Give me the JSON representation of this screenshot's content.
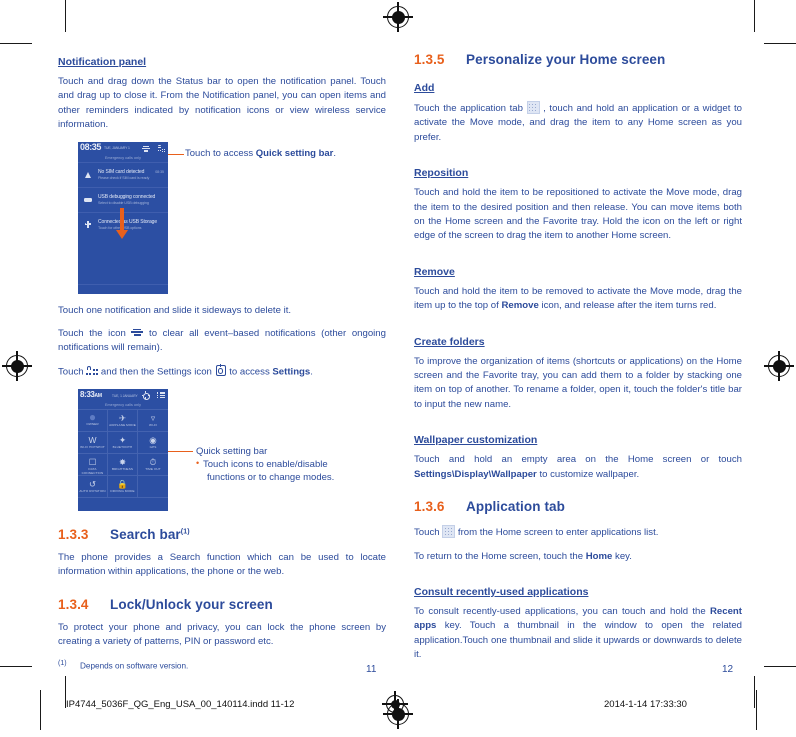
{
  "page": {
    "left_page_number": "11",
    "right_page_number": "12",
    "slug_left": "IP4744_5036F_QG_Eng_USA_00_140114.indd   11-12",
    "slug_right": "2014-1-14   17:33:30",
    "accent_orange": "#e8601c",
    "text_blue": "#2c4b9b",
    "screen_blue": "#2c4fa3"
  },
  "left_column": {
    "heading_notification_panel": "Notification panel",
    "para_1": "Touch and drag down the Status bar to open the notification panel. Touch and drag up to close it. From the Notification panel, you can open items and other reminders indicated by notification icons or view wireless service information.",
    "callout_1_prefix": "Touch to access ",
    "callout_1_bold": "Quick setting bar",
    "callout_1_suffix": ".",
    "para_2": "Touch one notification and slide it sideways to delete it.",
    "para_3_a": "Touch the icon ",
    "para_3_b": " to clear all event–based notifications (other ongoing notifications will remain).",
    "para_4_a": "Touch ",
    "para_4_b": " and then the Settings icon ",
    "para_4_c": " to access ",
    "para_4_bold": "Settings",
    "para_4_d": ".",
    "callout_2_title": "Quick setting bar",
    "callout_2_bullet_line1": "Touch icons to enable/disable",
    "callout_2_bullet_line2": "functions or to change modes.",
    "section_133_num": "1.3.3",
    "section_133_title": "Search bar",
    "section_133_sup": "(1)",
    "section_133_body": "The phone provides a Search function which can be used to locate information within applications, the phone or the web.",
    "section_134_num": "1.3.4",
    "section_134_title": "Lock/Unlock your screen",
    "section_134_body": "To protect your phone and privacy, you can lock the phone screen by creating a variety of patterns, PIN or password etc.",
    "footnote_mark": "(1)",
    "footnote_text": "Depends on software version."
  },
  "phone_notification_shot": {
    "status_time": "08:35",
    "status_date": "TUE, JANUARY 1",
    "carrier_text": "Emergency calls only",
    "status_icons": [
      "clear-all-icon",
      "quick-setting-icon"
    ],
    "notifications": [
      {
        "icon": "warning-icon",
        "title": "No SIM card detected",
        "subtitle": "Please check if SIM card is ready",
        "time": "08:35"
      },
      {
        "icon": "usb-icon",
        "title": "USB debugging connected",
        "subtitle": "Select to disable USB debugging",
        "time": ""
      },
      {
        "icon": "usb-storage-icon",
        "title": "Connected as USB Storage",
        "subtitle": "Touch for other USB options",
        "time": ""
      }
    ],
    "drag_arrow": "down-arrow"
  },
  "phone_quicksetting_shot": {
    "status_time": "8:33",
    "status_ampm": "AM",
    "status_date": "TUE, 1 JANUARY",
    "carrier_text": "Emergency calls only",
    "right_icons": [
      "settings-gear-icon",
      "list-icon"
    ],
    "tiles": [
      {
        "label": "OWNER",
        "glyph": "user-icon"
      },
      {
        "label": "AIRPLANE MODE",
        "glyph": "airplane-icon"
      },
      {
        "label": "WI-FI",
        "glyph": "wifi-icon"
      },
      {
        "label": "WI-FI HOTSPOT",
        "glyph": "hotspot-icon"
      },
      {
        "label": "BLUETOOTH",
        "glyph": "bluetooth-icon"
      },
      {
        "label": "GPS",
        "glyph": "gps-icon"
      },
      {
        "label": "DATA CONNECTION",
        "glyph": "data-icon"
      },
      {
        "label": "BRIGHTNESS",
        "glyph": "brightness-icon"
      },
      {
        "label": "TIME OUT",
        "glyph": "timeout-icon"
      },
      {
        "label": "AUTO ROTATION",
        "glyph": "rotation-icon"
      },
      {
        "label": "DRIVING MODE",
        "glyph": "driving-icon"
      },
      {
        "label": "",
        "glyph": ""
      }
    ]
  },
  "right_column": {
    "section_135_num": "1.3.5",
    "section_135_title": "Personalize your Home screen",
    "sub_add": "Add",
    "add_body_a": "Touch the application tab ",
    "add_body_b": " , touch and hold an application or a widget to activate the Move mode, and drag the item to any Home screen as you prefer.",
    "sub_reposition": "Reposition",
    "reposition_body": "Touch and hold the item to be repositioned to activate the Move mode, drag the item to the desired position and then release. You can move items both on the Home screen and the Favorite tray. Hold the icon on the left or right edge of the screen to drag the item to another Home screen.",
    "sub_remove": "Remove",
    "remove_body_a": "Touch and hold the item to be removed to activate the Move mode, drag the item up to the top of ",
    "remove_body_bold": "Remove",
    "remove_body_b": " icon, and release after the item turns red.",
    "sub_create_folders": "Create folders",
    "create_folders_body": "To improve the organization of items (shortcuts or applications) on the Home screen and the Favorite tray, you can add them to a folder by stacking one item on top of another. To rename a folder, open it, touch the folder's title bar to input the new name.",
    "sub_wallpaper": "Wallpaper customization",
    "wallpaper_body_a": "Touch and hold an empty area on the Home screen or touch ",
    "wallpaper_body_bold": "Settings\\Display\\Wallpaper",
    "wallpaper_body_b": " to customize wallpaper.",
    "section_136_num": "1.3.6",
    "section_136_title": "Application tab",
    "app_tab_body_a": "Touch ",
    "app_tab_body_b": " from the Home screen to enter applications list.",
    "app_tab_body_2a": "To return to the Home screen, touch the ",
    "app_tab_body_2bold": "Home",
    "app_tab_body_2b": " key.",
    "sub_consult": "Consult recently-used applications",
    "consult_body_a": "To consult recently-used applications, you can touch and hold the ",
    "consult_body_bold": "Recent apps",
    "consult_body_b": " key. Touch a thumbnail in the window to open the related application.Touch one thumbnail and slide it upwards or downwards to delete it."
  }
}
